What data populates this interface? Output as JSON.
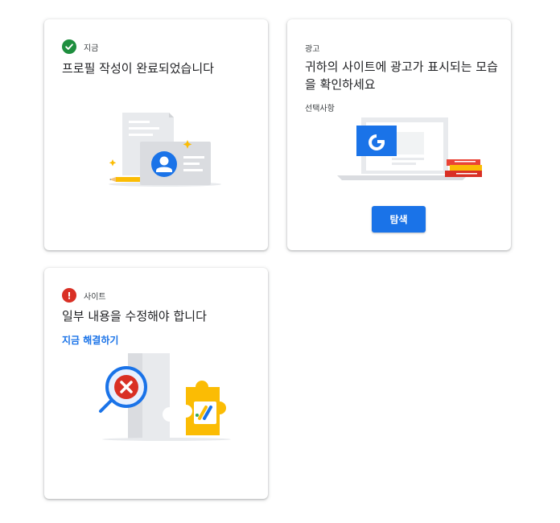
{
  "cards": [
    {
      "status": "지금",
      "status_color": "#1e8e3e",
      "status_icon": "check-circle-icon",
      "title": "프로필 작성이 완료되었습니다"
    },
    {
      "label": "광고",
      "title": "귀하의 사이트에 광고가 표시되는 모습을 확인하세요",
      "sub_label": "선택사항",
      "button_label": "탐색",
      "accent": "#1a73e8"
    },
    {
      "status": "사이트",
      "status_color": "#d93025",
      "status_icon": "error-circle-icon",
      "title": "일부 내용을 수정해야 합니다",
      "link_label": "지금 해결하기"
    }
  ]
}
